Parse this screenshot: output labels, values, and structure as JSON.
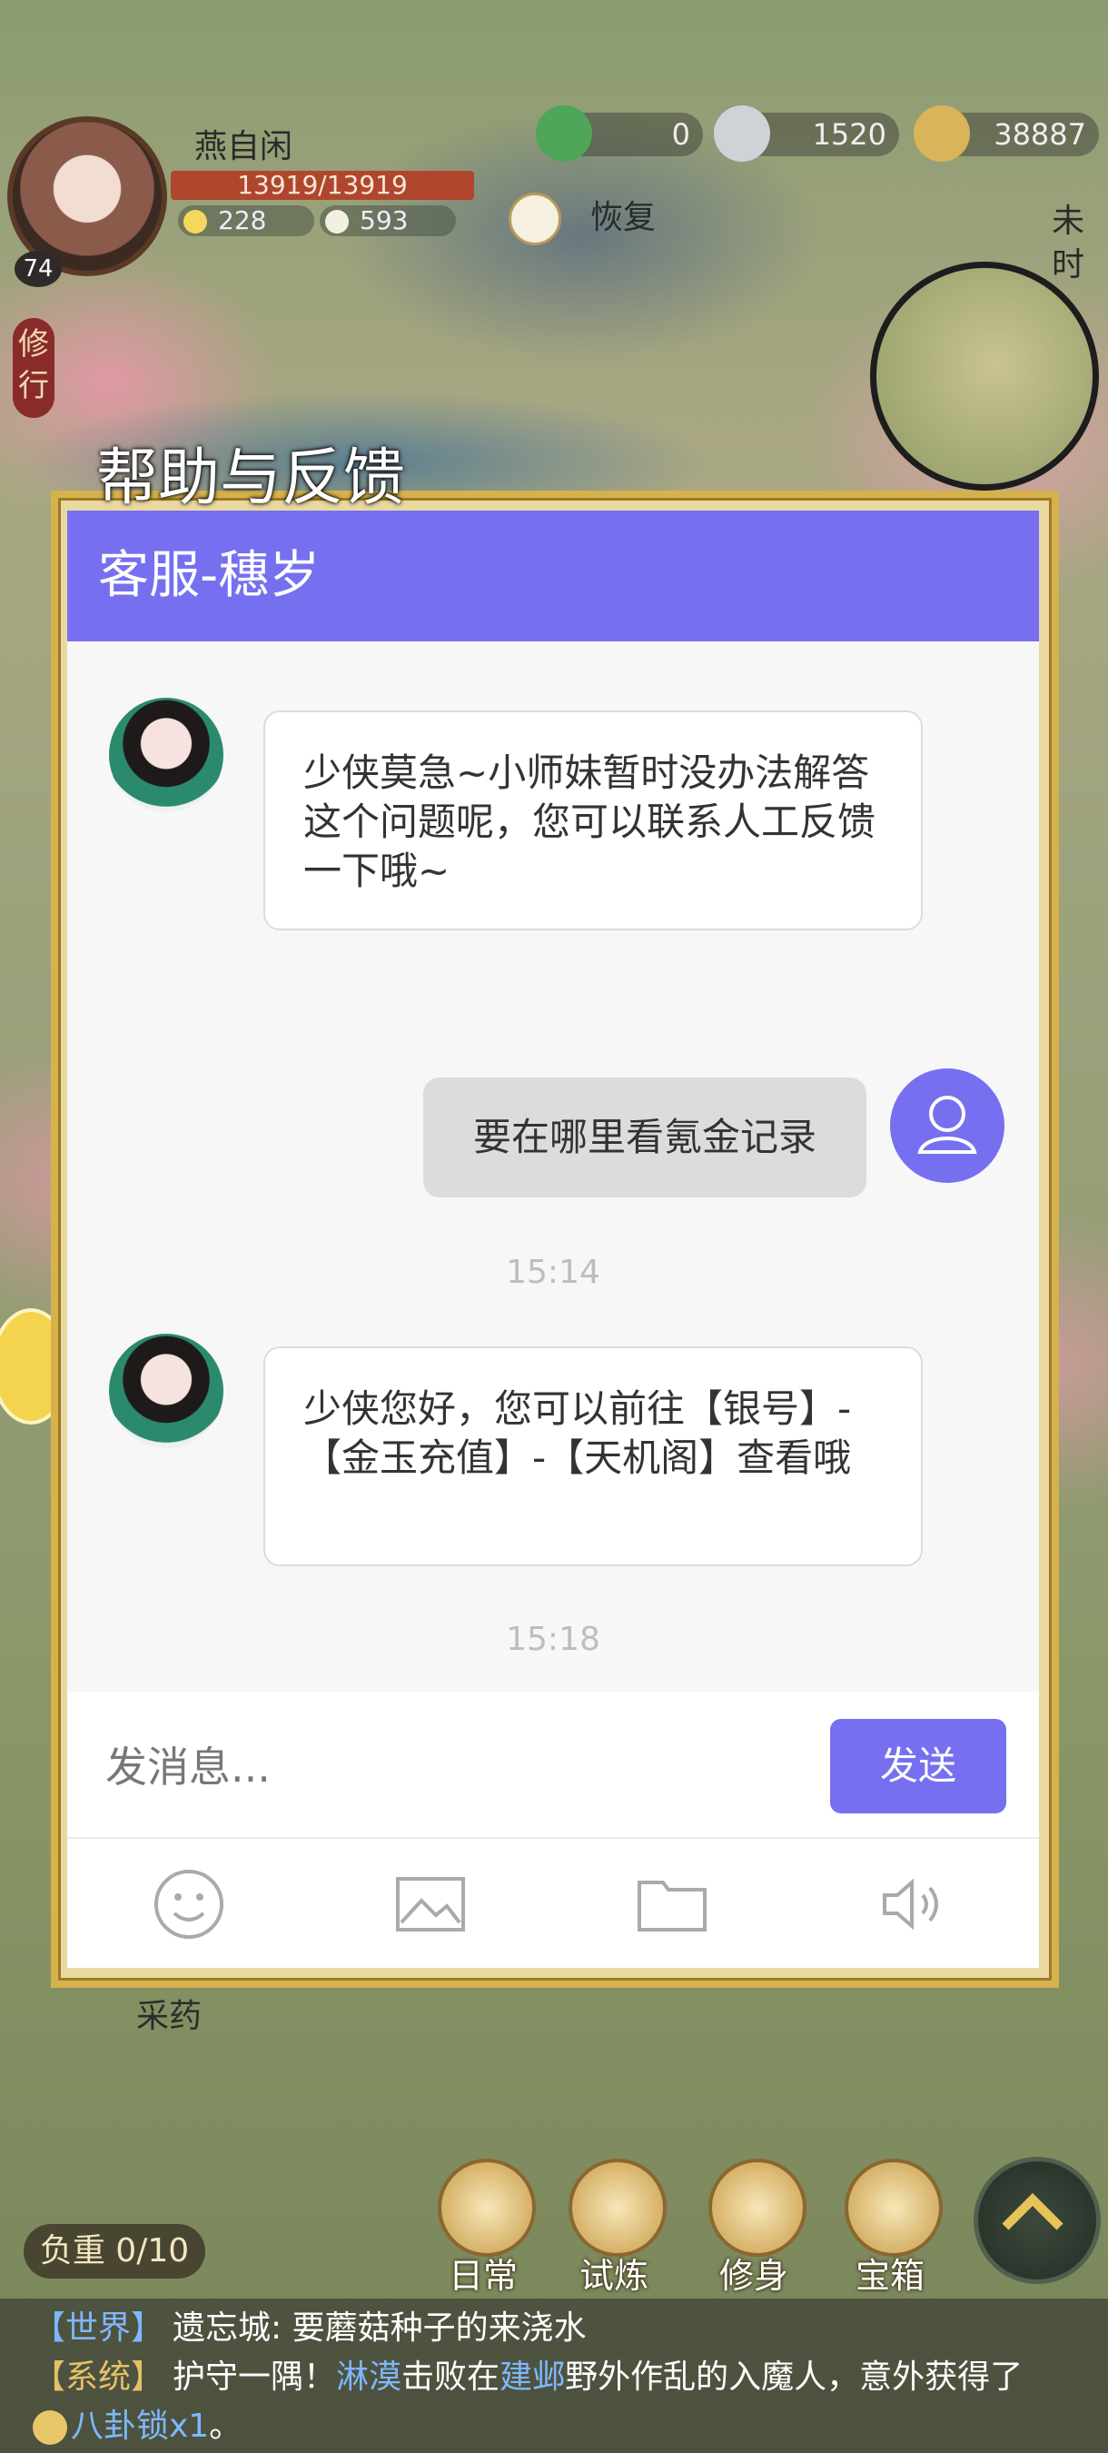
{
  "hud": {
    "player_name": "燕自闲",
    "level": "74",
    "hp": "13919/13919",
    "stat_1": "228",
    "stat_2": "593",
    "resources": [
      "0",
      "1520",
      "38887"
    ],
    "recover_label": "恢复",
    "side_tag": "修行",
    "map_side_text": "未时"
  },
  "dialog": {
    "title": "帮助与反馈",
    "header": "客服-穗岁",
    "messages": [
      {
        "from": "agent",
        "text": "少侠莫急~小师妹暂时没办法解答这个问题呢，您可以联系人工反馈一下哦~"
      },
      {
        "from": "user",
        "text": "要在哪里看氪金记录"
      },
      {
        "timestamp": "15:14"
      },
      {
        "from": "agent",
        "text": "少侠您好，您可以前往【银号】-【金玉充值】-【天机阁】查看哦"
      },
      {
        "timestamp": "15:18"
      }
    ],
    "input_placeholder": "发消息...",
    "send_label": "发送",
    "tools": [
      "emoji-icon",
      "image-icon",
      "folder-icon",
      "speaker-icon"
    ]
  },
  "bottom_bar": {
    "load_label": "负重 0/10",
    "collect_label": "采药",
    "buttons": [
      "日常",
      "试炼",
      "修身",
      "宝箱"
    ]
  },
  "chat_log": {
    "line1_channel": "【世界】",
    "line1_text": "遗忘城: 要蘑菇种子的来浇水",
    "line2_channel": "【系统】",
    "line2_pre": "护守一隅！",
    "line2_name1": "淋漠",
    "line2_mid": "击败在",
    "line2_name2": "建邺",
    "line2_post": "野外作乱的入魔人，意外获得了",
    "line3_item": "八卦锁x1",
    "line3_end": "。"
  }
}
